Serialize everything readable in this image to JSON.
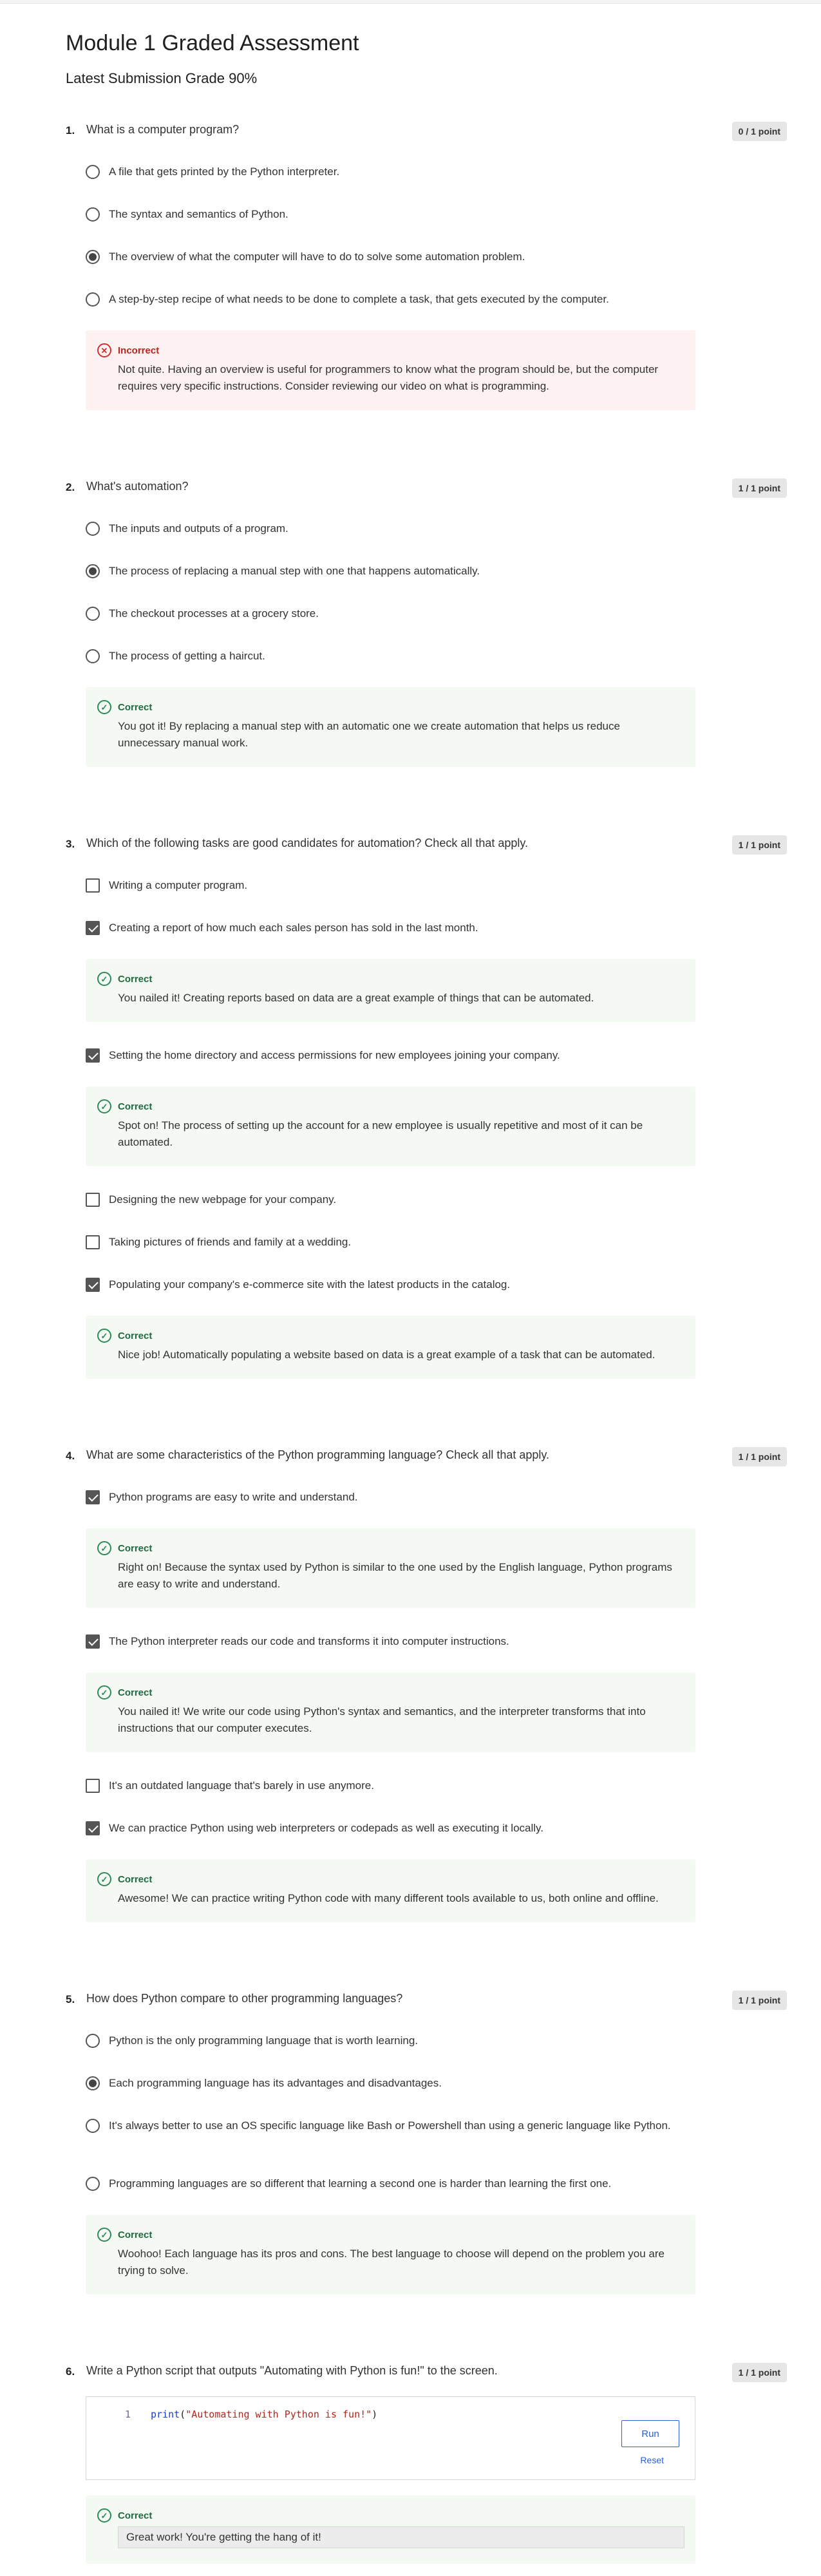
{
  "title": "Module 1 Graded Assessment",
  "grade": "Latest Submission Grade 90%",
  "questions": [
    {
      "num": "1.",
      "text": "What is a computer program?",
      "points": "0 / 1 point",
      "options": [
        "A file that gets printed by the Python interpreter.",
        "The syntax and semantics of Python.",
        "The overview of what the computer will have to do to solve some automation problem.",
        "A step-by-step recipe of what needs to be done to complete a task, that gets executed by the computer."
      ],
      "feedback": {
        "title": "Incorrect",
        "text": "Not quite. Having an overview is useful for programmers to know what the program should be, but the computer requires very specific instructions. Consider reviewing our video on what is programming."
      }
    },
    {
      "num": "2.",
      "text": "What's automation?",
      "points": "1 / 1 point",
      "options": [
        "The inputs and outputs of a program.",
        "The process of replacing a manual step with one that happens automatically.",
        "The checkout processes at a grocery store.",
        "The process of getting a haircut."
      ],
      "feedback": {
        "title": "Correct",
        "text": "You got it! By replacing a manual step with an automatic one we create automation that helps us reduce unnecessary manual work."
      }
    },
    {
      "num": "3.",
      "text": "Which of the following tasks are good candidates for automation? Check all that apply.",
      "points": "1 / 1 point",
      "options": [
        "Writing a computer program.",
        "Creating a report of how much each sales person has sold in the last month.",
        "Setting the home directory and access permissions for new employees joining your company.",
        "Designing the new webpage for your company.",
        "Taking pictures of friends and family at a wedding.",
        "Populating your company's e-commerce site with the latest products in the catalog."
      ],
      "feedback_title": "Correct",
      "feedbacks": [
        "You nailed it! Creating reports based on data are a great example of things that can be automated.",
        "Spot on! The process of setting up the account for a new employee is usually repetitive and most of it can be automated.",
        "Nice job! Automatically populating a website based on data is a great example of a task that can be automated."
      ]
    },
    {
      "num": "4.",
      "text": "What are some characteristics of the Python programming language? Check all that apply.",
      "points": "1 / 1 point",
      "options": [
        "Python programs are easy to write and understand.",
        "The Python interpreter reads our code and transforms it into computer instructions.",
        "It's an outdated language that's barely in use anymore.",
        "We can practice Python using web interpreters or codepads as well as executing it locally."
      ],
      "feedback_title": "Correct",
      "feedbacks": [
        "Right on! Because the syntax used by Python is similar to the one used by the English language, Python programs are easy to write and understand.",
        "You nailed it! We write our code using Python's syntax and semantics, and the interpreter transforms that into instructions that our computer executes.",
        "Awesome! We can practice writing Python code with many different tools available to us, both online and offline."
      ]
    },
    {
      "num": "5.",
      "text": "How does Python compare to other programming languages?",
      "points": "1 / 1 point",
      "options": [
        "Python is the only programming language that is worth learning.",
        "Each programming language has its advantages and disadvantages.",
        "It's always better to use an OS specific language like Bash or Powershell than using a generic language like Python.",
        "Programming languages are so different that learning a second one is harder than learning the first one."
      ],
      "feedback": {
        "title": "Correct",
        "text": "Woohoo! Each language has its pros and cons. The best language to choose will depend on the problem you are trying to solve."
      }
    },
    {
      "num": "6.",
      "text": "Write a Python script that outputs \"Automating with Python is fun!\" to the screen.",
      "points": "1 / 1 point",
      "code_line_num": "1",
      "code_fn": "print",
      "code_open": "(",
      "code_str": "\"Automating with Python is fun!\"",
      "code_close": ")",
      "run_label": "Run",
      "reset_label": "Reset",
      "feedback_title": "Correct",
      "output": "Great work! You're getting the hang of it!"
    }
  ]
}
